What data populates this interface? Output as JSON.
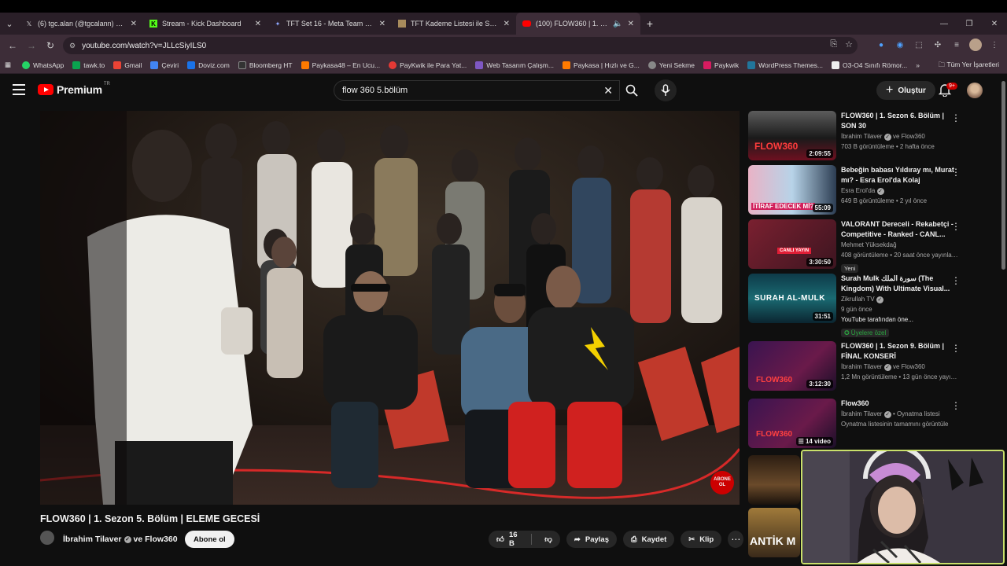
{
  "browser": {
    "tabs": [
      {
        "icon": "x-logo-icon",
        "title": "(6) tgc.alan (@tgcalann) adlı ku",
        "active": false
      },
      {
        "icon": "kick-logo-icon",
        "title": "Stream - Kick Dashboard",
        "active": false
      },
      {
        "icon": "tft-icon",
        "title": "TFT Set 16 - Meta Team Comps",
        "active": false
      },
      {
        "icon": "tft-list-icon",
        "title": "TFT Kademe Listesi ile Set 16 iç",
        "active": false
      },
      {
        "icon": "youtube-tab-icon",
        "title": "(100) FLOW360 | 1. Sezon 5",
        "active": true
      }
    ],
    "url": "youtube.com/watch?v=JLLcSiyILS0",
    "bookmarks": [
      {
        "label": "WhatsApp",
        "color": "#25d366"
      },
      {
        "label": "tawk.to",
        "color": "#0aa34f"
      },
      {
        "label": "Gmail",
        "color": "#ea4335"
      },
      {
        "label": "Çeviri",
        "color": "#4285f4"
      },
      {
        "label": "Doviz.com",
        "color": "#1a73e8"
      },
      {
        "label": "Bloomberg HT",
        "color": "#333333"
      },
      {
        "label": "Paykasa48 – En Ucu...",
        "color": "#ff7a00"
      },
      {
        "label": "PayKwik ile Para Yat...",
        "color": "#e53935"
      },
      {
        "label": "Web Tasarım Çalışm...",
        "color": "#7e57c2"
      },
      {
        "label": "Paykasa | Hızlı ve G...",
        "color": "#ff7a00"
      },
      {
        "label": "Yeni Sekme",
        "color": "#888888"
      },
      {
        "label": "Paykwik",
        "color": "#d81b60"
      },
      {
        "label": "WordPress Themes...",
        "color": "#21759b"
      },
      {
        "label": "O3-O4 Sınıfı Römor...",
        "color": "#eeeeee"
      }
    ],
    "all_bookmarks": "Tüm Yer İşaretleri"
  },
  "youtube": {
    "logo_text": "Premium",
    "logo_region": "TR",
    "search_query": "flow 360 5.bölüm",
    "create_label": "Oluştur",
    "notification_count": "9+",
    "video": {
      "title": "FLOW360 | 1. Sezon 5. Bölüm | ELEME GECESİ",
      "channel": "İbrahim Tilaver",
      "collab": "ve Flow360",
      "subscribe": "Abone ol",
      "likes": "16 B",
      "share": "Paylaş",
      "save": "Kaydet",
      "clip": "Klip",
      "overlay_badge": "ABONE OL"
    },
    "recommendations": [
      {
        "title": "FLOW360 | 1. Sezon 6. Bölüm | SON 30",
        "channel": "İbrahim Tilaver",
        "collab": "ve Flow360",
        "stats": "703 B görüntüleme • 2 hafta önce",
        "duration": "2:09:55",
        "thumb_text": "FLOW360"
      },
      {
        "title": "Bebeğin babası Yıldıray mı, Murat mı? - Esra Erol'da Kolaj",
        "channel": "Esra Erol'da",
        "collab": "",
        "stats": "649 B görüntüleme • 2 yıl önce",
        "duration": "55:09",
        "thumb_text": "İTİRAF EDECEK Mİ?"
      },
      {
        "title": "VALORANT Dereceli - Rekabetçi - Competitive - Ranked - CANL...",
        "channel": "Mehmet Yüksekdağ",
        "collab": "",
        "stats": "408 görüntüleme • 20 saat önce yayınlan...",
        "duration": "3:30:50",
        "badge": "Yeni",
        "thumb_text": "CANLI YAYIN"
      },
      {
        "title": "Surah Mulk سورة الملك (The Kingdom) With Ultimate Visual...",
        "channel": "Zikrullah TV",
        "collab": "",
        "stats": "9 gün önce",
        "duration": "31:51",
        "extra": "YouTube tarafından öne...",
        "members": "Üyelere özel",
        "thumb_text": "SURAH AL-MULK"
      },
      {
        "title": "FLOW360 | 1. Sezon 9. Bölüm | FİNAL KONSERİ",
        "channel": "İbrahim Tilaver",
        "collab": "ve Flow360",
        "stats": "1,2 Mn görüntüleme • 13 gün önce yayınl...",
        "duration": "3:12:30",
        "thumb_text": "FLOW360"
      },
      {
        "title": "Flow360",
        "channel": "İbrahim Tilaver",
        "collab": "• Oynatma listesi",
        "stats": "Oynatma listesinin tamamını görüntüle",
        "duration": "14 video",
        "thumb_text": "FLOW360"
      },
      {
        "title": "",
        "channel": "",
        "collab": "",
        "stats": "",
        "duration": "",
        "thumb_text": ""
      },
      {
        "title": "",
        "channel": "",
        "collab": "",
        "stats": "",
        "duration": "",
        "thumb_text": "ANTİK M"
      }
    ]
  }
}
